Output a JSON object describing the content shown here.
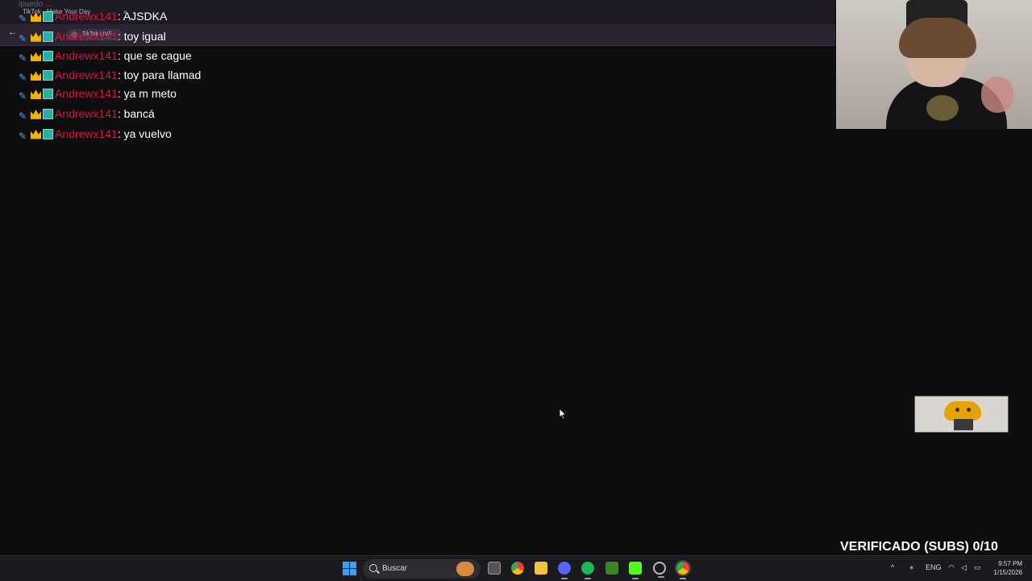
{
  "browser": {
    "tab_title": "TikTok - Make Your Day",
    "tab_close": "×",
    "back_glyph": "←",
    "address_pill": "TikTok LIVE"
  },
  "chat_top_fragment": "ipuedo ...",
  "chat": [
    {
      "user": "Andrewx141",
      "sep": ":",
      "text": " AJSDKA"
    },
    {
      "user": "Andrewx141",
      "sep": ":",
      "text": " toy igual"
    },
    {
      "user": "Andrewx141",
      "sep": ":",
      "text": " que se cague"
    },
    {
      "user": "Andrewx141",
      "sep": ":",
      "text": " toy para llamad"
    },
    {
      "user": "Andrewx141",
      "sep": ":",
      "text": " ya m meto"
    },
    {
      "user": "Andrewx141",
      "sep": ":",
      "text": " bancá"
    },
    {
      "user": "Andrewx141",
      "sep": ":",
      "text": " ya vuelvo"
    }
  ],
  "overlay": {
    "verificado": "VERIFICADO (SUBS) 0/10"
  },
  "taskbar": {
    "search_label": "Buscar",
    "lang": "ENG",
    "time": "9:57 PM",
    "date": "1/15/2026"
  },
  "colors": {
    "username": "#e0123f",
    "background": "#0e0d0f",
    "taskbar": "#1b1b1f"
  }
}
